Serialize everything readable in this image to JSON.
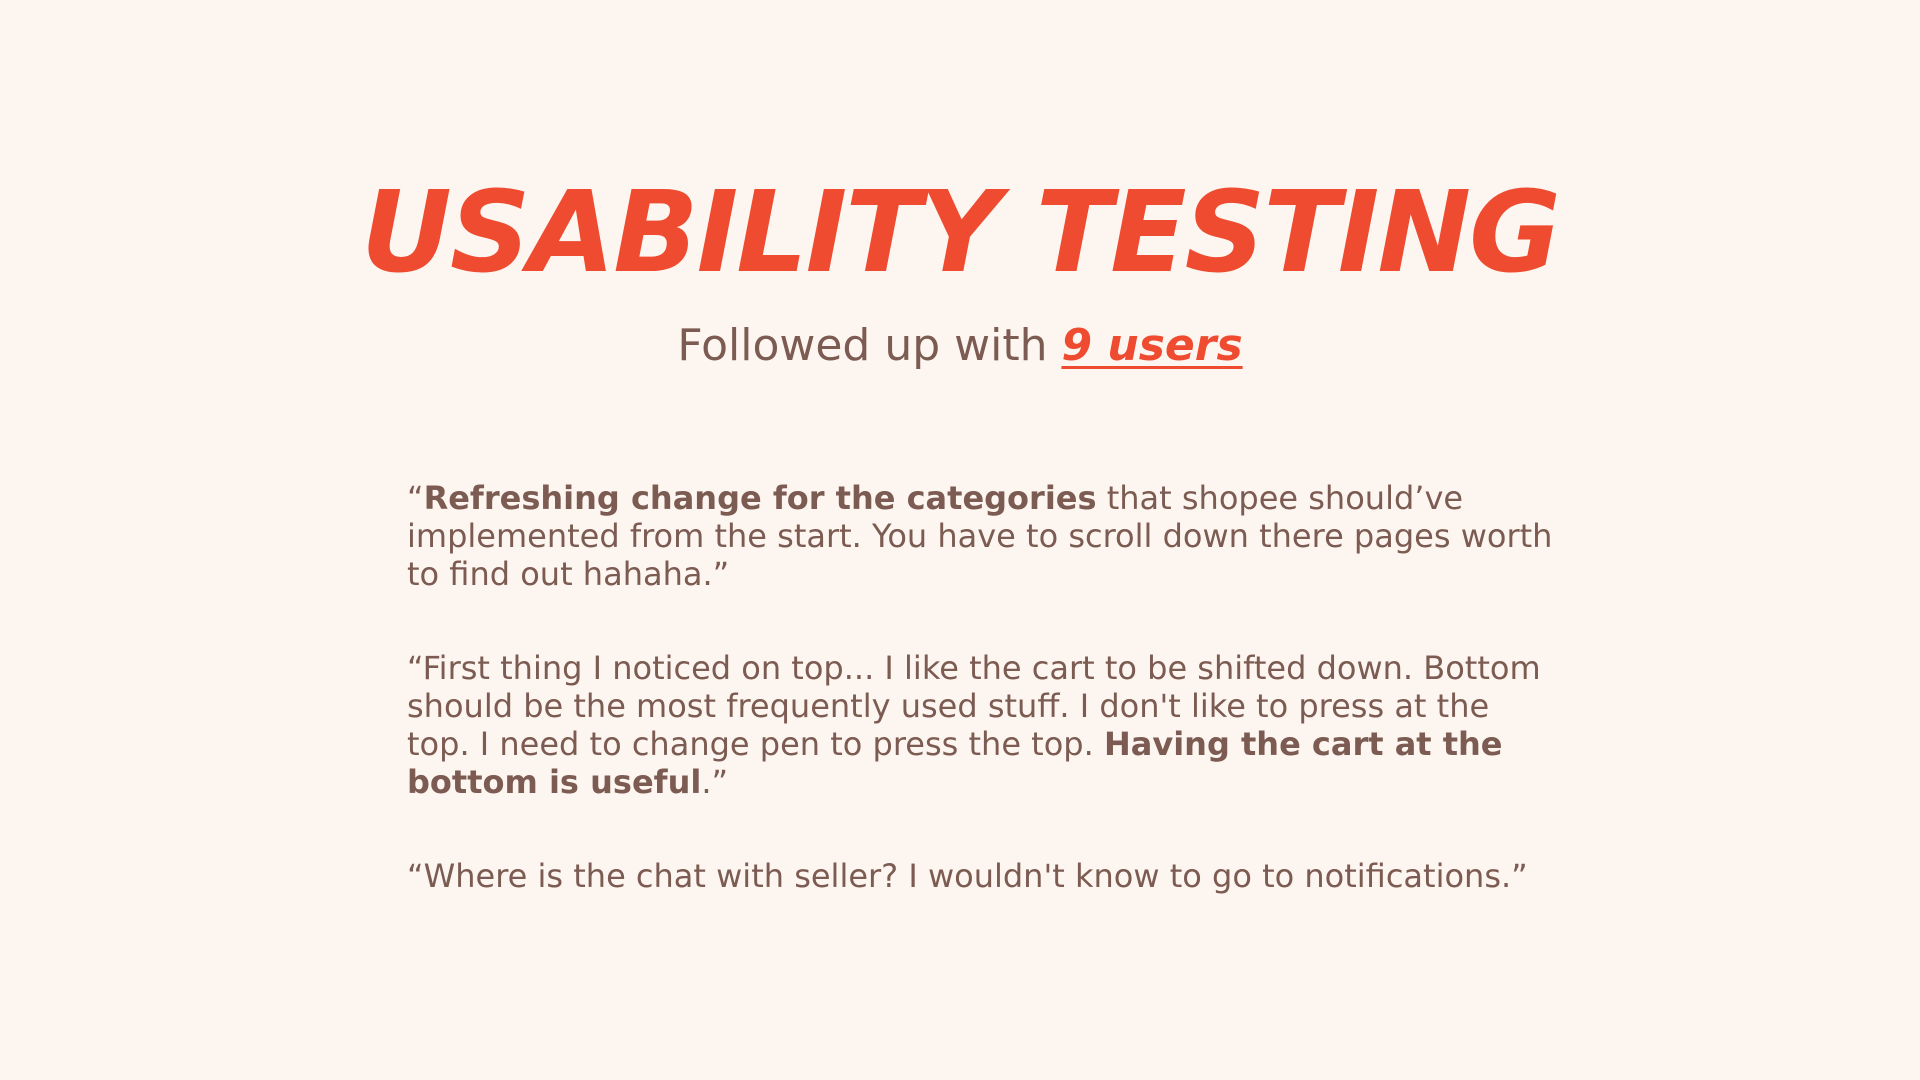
{
  "slide": {
    "title": "USABILITY TESTING",
    "subtitle_prefix": "Followed up with ",
    "subtitle_highlight": "9 users"
  },
  "quotes": [
    {
      "segments": [
        {
          "text": "“",
          "bold": false
        },
        {
          "text": "Refreshing change for the categories",
          "bold": true
        },
        {
          "text": " that shopee should’ve implemented from the start. You have to scroll down there pages worth to find out hahaha.”",
          "bold": false
        }
      ]
    },
    {
      "segments": [
        {
          "text": "“First thing I noticed on top... I like the cart to be shifted down. Bottom should be the most frequently used stuff. I don't like to press at the top. I need to change pen to press the top. ",
          "bold": false
        },
        {
          "text": "Having the cart at the bottom is useful",
          "bold": true
        },
        {
          "text": ".”",
          "bold": false
        }
      ]
    },
    {
      "segments": [
        {
          "text": "“Where is the chat with seller? I wouldn't know to go to notifications.”",
          "bold": false
        }
      ]
    }
  ],
  "colors": {
    "background": "#fdf5ef",
    "accent": "#ee4b30",
    "text": "#7b5b52"
  }
}
